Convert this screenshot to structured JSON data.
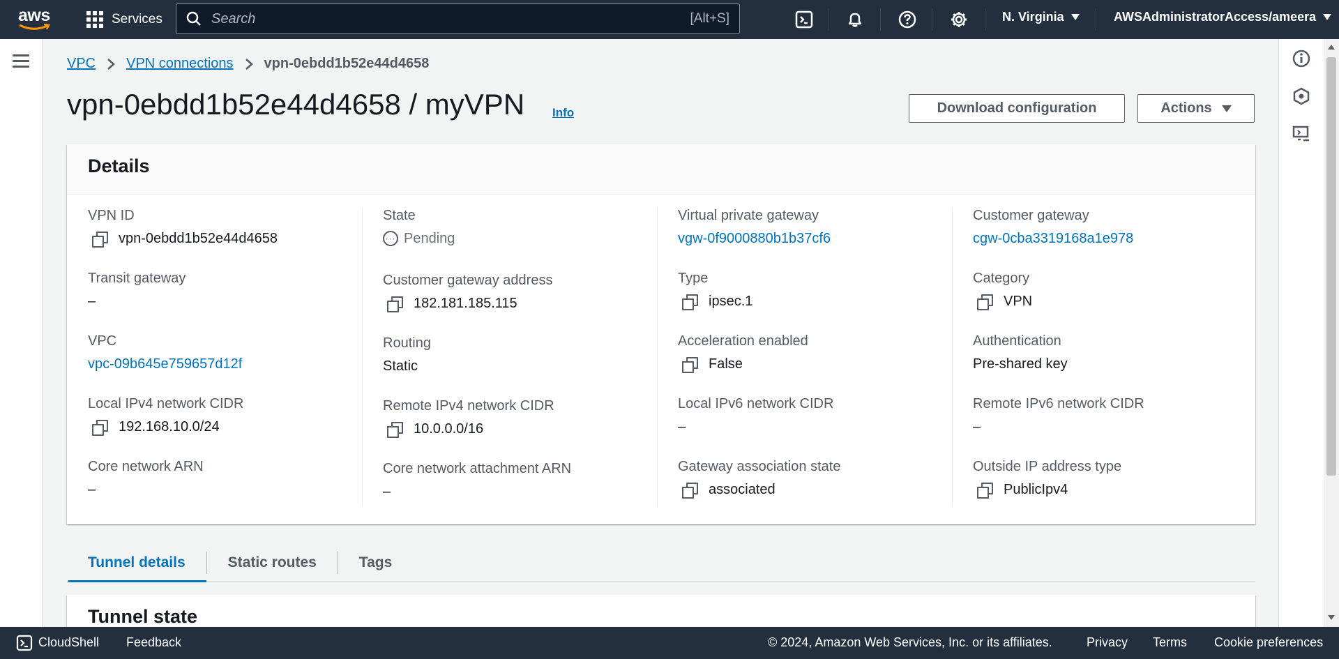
{
  "topnav": {
    "logo_text": "aws",
    "services_label": "Services",
    "search_placeholder": "Search",
    "search_shortcut": "[Alt+S]",
    "region": "N. Virginia",
    "account": "AWSAdministratorAccess/ameera"
  },
  "breadcrumb": {
    "items": [
      "VPC",
      "VPN connections"
    ],
    "current": "vpn-0ebdd1b52e44d4658"
  },
  "header": {
    "title": "vpn-0ebdd1b52e44d4658 / myVPN",
    "info": "Info",
    "download_label": "Download configuration",
    "actions_label": "Actions"
  },
  "details": {
    "title": "Details",
    "columns": [
      [
        {
          "label": "VPN ID",
          "value": "vpn-0ebdd1b52e44d4658",
          "copy": true
        },
        {
          "label": "Transit gateway",
          "value": "–"
        },
        {
          "label": "VPC",
          "value": "vpc-09b645e759657d12f",
          "link": true
        },
        {
          "label": "Local IPv4 network CIDR",
          "value": "192.168.10.0/24",
          "copy": true
        },
        {
          "label": "Core network ARN",
          "value": "–"
        }
      ],
      [
        {
          "label": "State",
          "value": "Pending",
          "status": "pending"
        },
        {
          "label": "Customer gateway address",
          "value": "182.181.185.115",
          "copy": true
        },
        {
          "label": "Routing",
          "value": "Static"
        },
        {
          "label": "Remote IPv4 network CIDR",
          "value": "10.0.0.0/16",
          "copy": true
        },
        {
          "label": "Core network attachment ARN",
          "value": "–"
        }
      ],
      [
        {
          "label": "Virtual private gateway",
          "value": "vgw-0f9000880b1b37cf6",
          "link": true
        },
        {
          "label": "Type",
          "value": "ipsec.1",
          "copy": true
        },
        {
          "label": "Acceleration enabled",
          "value": "False",
          "copy": true
        },
        {
          "label": "Local IPv6 network CIDR",
          "value": "–"
        },
        {
          "label": "Gateway association state",
          "value": "associated",
          "copy": true
        }
      ],
      [
        {
          "label": "Customer gateway",
          "value": "cgw-0cba3319168a1e978",
          "link": true
        },
        {
          "label": "Category",
          "value": "VPN",
          "copy": true
        },
        {
          "label": "Authentication",
          "value": "Pre-shared key"
        },
        {
          "label": "Remote IPv6 network CIDR",
          "value": "–"
        },
        {
          "label": "Outside IP address type",
          "value": "PublicIpv4",
          "copy": true
        }
      ]
    ]
  },
  "tabs": [
    {
      "label": "Tunnel details",
      "active": true
    },
    {
      "label": "Static routes",
      "active": false
    },
    {
      "label": "Tags",
      "active": false
    }
  ],
  "tunnel_panel": {
    "title": "Tunnel state"
  },
  "footer": {
    "cloudshell": "CloudShell",
    "feedback": "Feedback",
    "copyright": "© 2024, Amazon Web Services, Inc. or its affiliates.",
    "privacy": "Privacy",
    "terms": "Terms",
    "cookies": "Cookie preferences"
  },
  "colors": {
    "nav_bg": "#232f3e",
    "link": "#0073bb",
    "page_bg": "#f2f3f3",
    "text": "#16191f",
    "muted": "#545b64"
  }
}
